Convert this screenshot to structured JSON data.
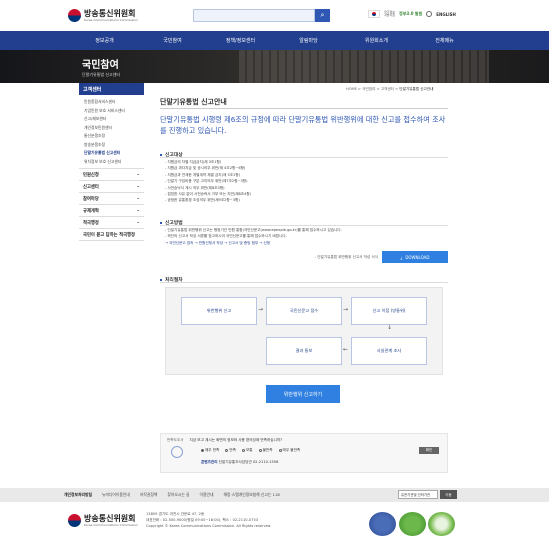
{
  "header": {
    "logo_ko": "방송통신위원회",
    "logo_en": "Korea Communications Commission",
    "search_placeholder": "",
    "util_line1": "국가정보",
    "util_line2": "개방자료",
    "gov3": "정부3.0 발원",
    "english": "ENGLISH"
  },
  "gnb": [
    "정보공개",
    "국민참여",
    "정책/정보센터",
    "알림마당",
    "위원회소개",
    "전체메뉴"
  ],
  "visual": {
    "title": "국민참여",
    "subtitle": "단말기유통법 신고센터"
  },
  "lnb": {
    "head": "고객센터",
    "sub": [
      "민원종합서비스센터",
      "기업민원 보호 서비스센터",
      "신고/제보센터",
      "개인정보민원센터",
      "통신분쟁조정",
      "방송분쟁조정",
      "단말기유통법 신고센터",
      "위치정보 보호 신고센터"
    ],
    "active_index": 6,
    "items": [
      "민원신청",
      "신고센터",
      "참여마당",
      "규제개혁",
      "적극행정",
      "국민이 묻고 답하는 적극행정"
    ]
  },
  "breadcrumb": {
    "home": "HOME",
    "p1": "국민참여",
    "p2": "고객센터",
    "current": "단말기유통법 신고안내"
  },
  "page_title": "단말기유통법 신고안내",
  "lead": "단말기유통법 시행령 제6조의 규정에 따라 단말기유통법 위반행위에 대한 신고를 접수하여 조사를 진행하고 있습니다.",
  "target": {
    "title": "신고대상",
    "items": [
      "- 지원금의 차별 지급금지(제 3조1항)",
      "- 지원금 과다지급 및 공시의무 위반(제 4조2항~6항)",
      "- 지원금과 연계한 개별계약 체결 금지(제 5조1항)",
      "- 단말기 구입비용 구분 고지의무 위반(제7조2항~3항)",
      "- 사전승낙서 게시 의무 위반(제8조3항)",
      "- 접업한 사유 없이 사전승락서 거부 또는 지연(제8조4항)",
      "- 공정한 유통환경 조성의무 위반(제9조2항~3항)"
    ]
  },
  "method": {
    "title": "신고방법",
    "items": [
      "- 단말기유통법 위반행위 신고는 행정기관 민원 통합(국민신문고(www.epeople.go.kr)를 통해 접수하시고 있습니다.",
      "- 하단의 신고서 작성 서류를 참고하시어 국민신문고를 통해 접수하시기 바랍니다."
    ],
    "step": "→ 국민신문고 접속 → 민원신청서 작성 → 신고서 및 증빙 첨부 → 신청"
  },
  "download": {
    "label": "- 단말기유통법 위반행위 신고서 작성 서식",
    "button": "DOWNLOAD"
  },
  "process": {
    "title": "처리절차",
    "steps": [
      "위반행위 신고",
      "국민신문고 접수",
      "신고 이첩 (방통위)",
      "사실관계 조사",
      "결과 통보"
    ]
  },
  "report_button": "위반행위 신고하기",
  "survey": {
    "label": "만족도조사",
    "question": "지금 보고 계시는 화면의 정보와 사용 편의성에 만족하십니까?",
    "options": [
      "매우 만족",
      "만족",
      "보통",
      "불만족",
      "매우 불만족"
    ],
    "selected_index": 0,
    "submit": "확인",
    "manager_label": "콘텐츠관리",
    "manager": "단말기유통조사담당관 02-2110-1556"
  },
  "footer": {
    "links": [
      "개인정보처리방침",
      "뉴미디어이용안내",
      "저작권정책",
      "찾아오시는 길",
      "이용안내",
      "해킹·스팸개인정보침해 신고는 118"
    ],
    "select": "유관기관및 산하기관",
    "go": "이동",
    "info": [
      "13809 경기도 과천시 관문로 47, 2동",
      "대표전화 : 02-500-9000(평일 09:00~18:00), 팩스 : 02-2110-0753",
      "Copyright © Korea Communications Commission. All Rights reserved."
    ]
  }
}
